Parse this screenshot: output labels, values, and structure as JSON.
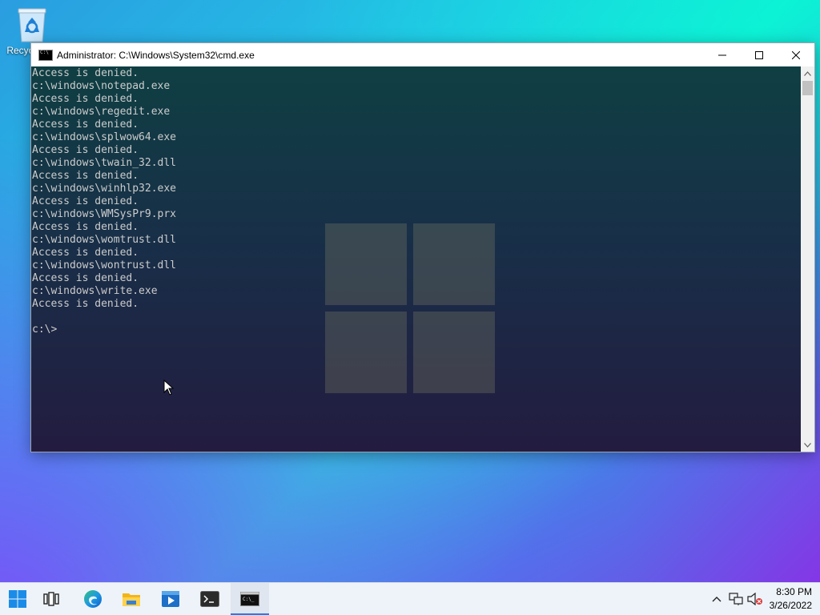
{
  "desktop": {
    "recycle_bin_label": "Recycle Bin"
  },
  "window": {
    "title": "Administrator: C:\\Windows\\System32\\cmd.exe",
    "console_lines": [
      "Access is denied.",
      "c:\\windows\\notepad.exe",
      "Access is denied.",
      "c:\\windows\\regedit.exe",
      "Access is denied.",
      "c:\\windows\\splwow64.exe",
      "Access is denied.",
      "c:\\windows\\twain_32.dll",
      "Access is denied.",
      "c:\\windows\\winhlp32.exe",
      "Access is denied.",
      "c:\\windows\\WMSysPr9.prx",
      "Access is denied.",
      "c:\\windows\\womtrust.dll",
      "Access is denied.",
      "c:\\windows\\wontrust.dll",
      "Access is denied.",
      "c:\\windows\\write.exe",
      "Access is denied.",
      "",
      "c:\\>"
    ]
  },
  "taskbar": {
    "items": [
      "start",
      "task-view",
      "edge",
      "file-explorer",
      "media-player",
      "terminal",
      "cmd"
    ],
    "active_item": "cmd",
    "clock_time": "8:30 PM",
    "clock_date": "3/26/2022"
  },
  "colors": {
    "accent": "#2c7be5",
    "console_text": "#cccccc"
  }
}
